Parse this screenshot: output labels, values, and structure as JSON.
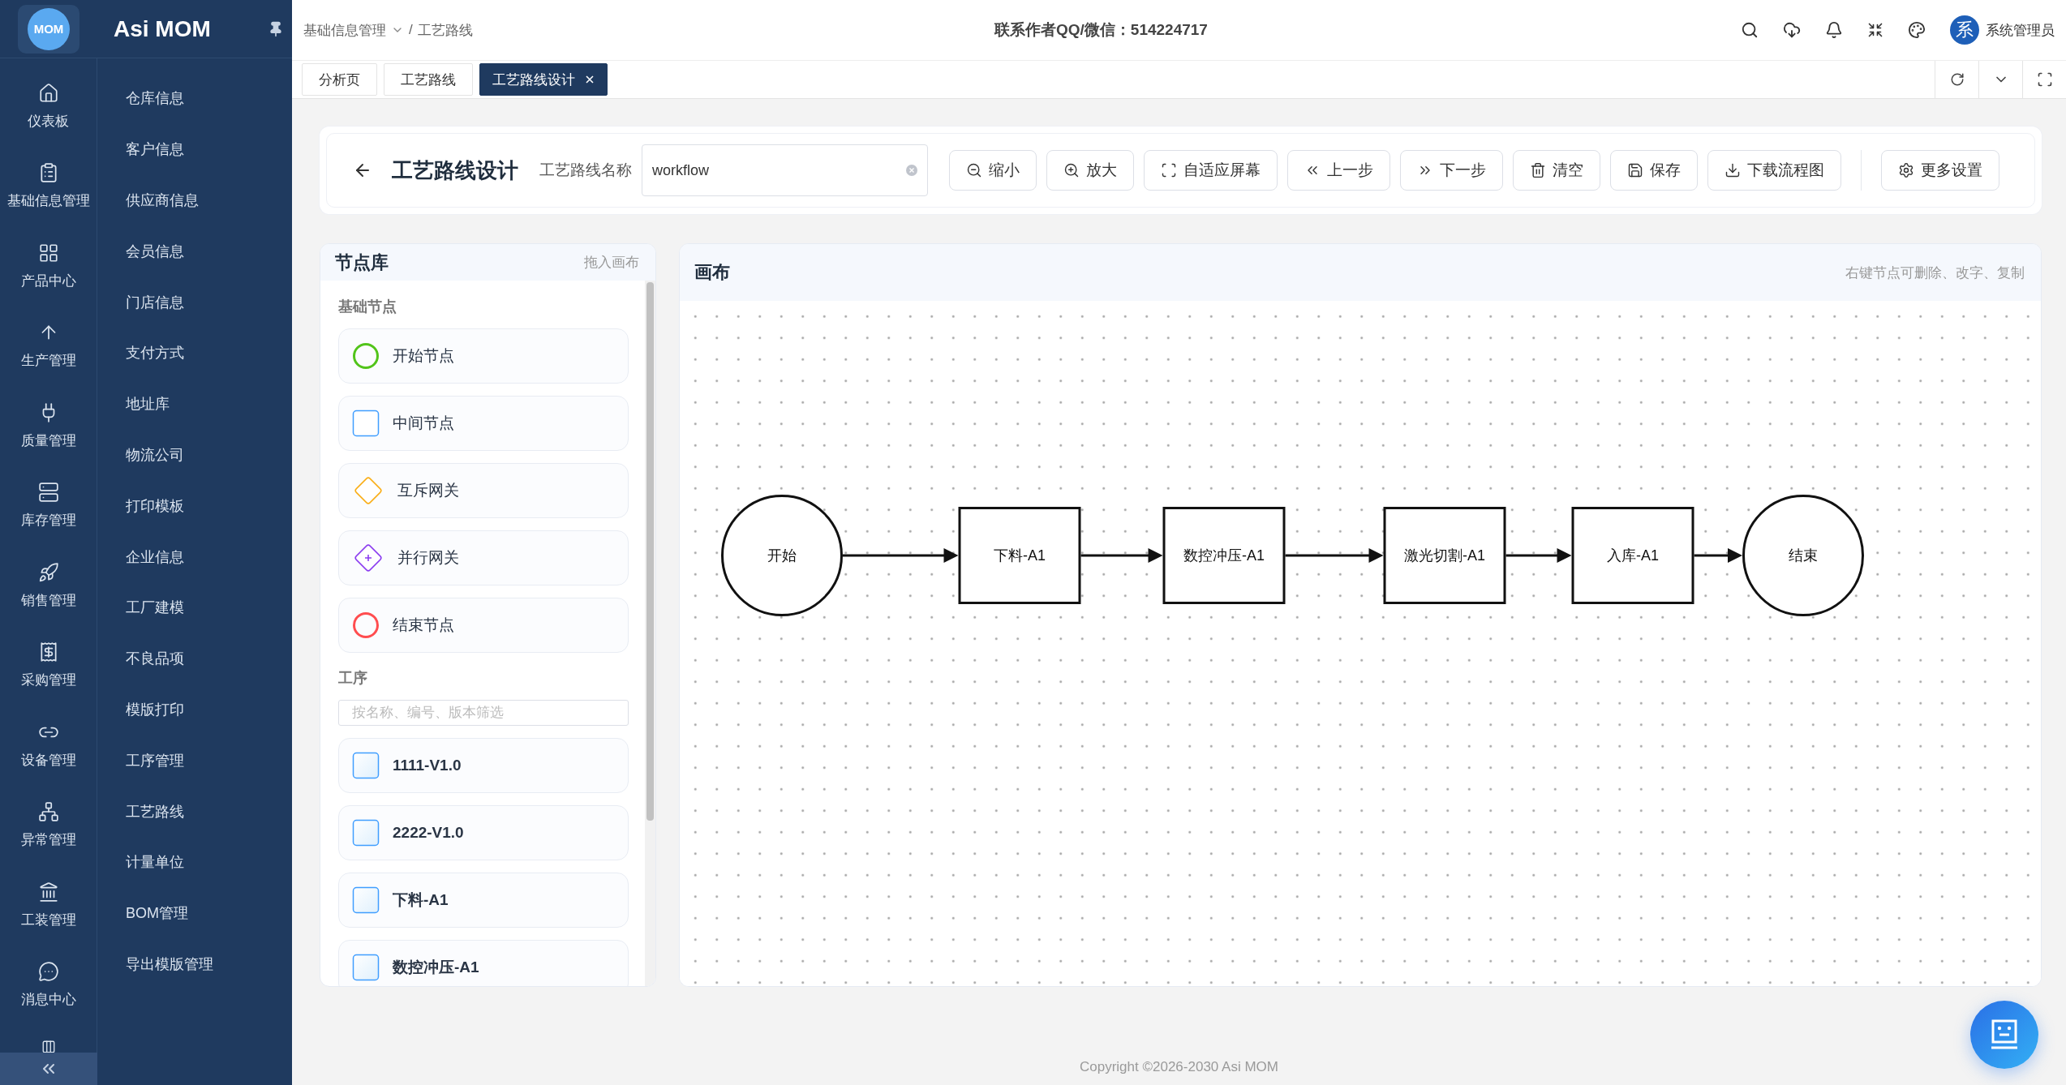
{
  "sidebar": {
    "logo_text": "MOM",
    "app_name": "Asi MOM",
    "rail": [
      {
        "kind": "home",
        "label": "仪表板"
      },
      {
        "kind": "clipboard",
        "label": "基础信息管理"
      },
      {
        "kind": "grid",
        "label": "产品中心"
      },
      {
        "kind": "arrow-up",
        "label": "生产管理"
      },
      {
        "kind": "plug",
        "label": "质量管理"
      },
      {
        "kind": "cabinet",
        "label": "库存管理"
      },
      {
        "kind": "rocket",
        "label": "销售管理"
      },
      {
        "kind": "receipt",
        "label": "采购管理"
      },
      {
        "kind": "link",
        "label": "设备管理"
      },
      {
        "kind": "network",
        "label": "异常管理"
      },
      {
        "kind": "bank",
        "label": "工装管理"
      },
      {
        "kind": "chat",
        "label": "消息中心"
      }
    ],
    "submenu": [
      "仓库信息",
      "客户信息",
      "供应商信息",
      "会员信息",
      "门店信息",
      "支付方式",
      "地址库",
      "物流公司",
      "打印模板",
      "企业信息",
      "工厂建模",
      "不良品项",
      "模版打印",
      "工序管理",
      "工艺路线",
      "计量单位",
      "BOM管理",
      "导出模版管理"
    ]
  },
  "header": {
    "breadcrumb": {
      "parent": "基础信息管理",
      "separator": "/",
      "current": "工艺路线"
    },
    "contact": "联系作者QQ/微信：514224717",
    "avatar": "系",
    "user": "系统管理员"
  },
  "tabs": [
    {
      "label": "分析页",
      "selected": false
    },
    {
      "label": "工艺路线",
      "selected": false
    },
    {
      "label": "工艺路线设计",
      "selected": true
    }
  ],
  "toolbar": {
    "title": "工艺路线设计",
    "name_label": "工艺路线名称",
    "name_value": "workflow",
    "buttons": [
      {
        "kind": "zoom-out",
        "label": "缩小"
      },
      {
        "kind": "zoom-in",
        "label": "放大"
      },
      {
        "kind": "fit",
        "label": "自适应屏幕"
      },
      {
        "kind": "undo",
        "label": "上一步"
      },
      {
        "kind": "redo",
        "label": "下一步"
      },
      {
        "kind": "clear",
        "label": "清空"
      },
      {
        "kind": "save",
        "label": "保存"
      },
      {
        "kind": "download",
        "label": "下载流程图"
      },
      {
        "kind": "settings",
        "label": "更多设置"
      }
    ]
  },
  "node_library": {
    "title": "节点库",
    "hint": "拖入画布",
    "basic_section": "基础节点",
    "basic_nodes": [
      {
        "kind": "start",
        "label": "开始节点",
        "color": "#52c41a"
      },
      {
        "kind": "task",
        "label": "中间节点",
        "color": "#409eff"
      },
      {
        "kind": "exclusive",
        "label": "互斥网关",
        "color": "#faad14"
      },
      {
        "kind": "parallel",
        "label": "并行网关",
        "color": "#8b3cf0"
      },
      {
        "kind": "end",
        "label": "结束节点",
        "color": "#ff4d4f"
      }
    ],
    "process_section": "工序",
    "filter_placeholder": "按名称、编号、版本筛选",
    "processes": [
      "1111-V1.0",
      "2222-V1.0",
      "下料-A1",
      "数控冲压-A1"
    ]
  },
  "canvas": {
    "title": "画布",
    "hint": "右键节点可删除、改字、复制",
    "nodes": [
      {
        "kind": "start",
        "label": "开始"
      },
      {
        "kind": "task",
        "label": "下料-A1"
      },
      {
        "kind": "task",
        "label": "数控冲压-A1"
      },
      {
        "kind": "task",
        "label": "激光切割-A1"
      },
      {
        "kind": "task",
        "label": "入库-A1"
      },
      {
        "kind": "end",
        "label": "结束"
      }
    ]
  },
  "footer": {
    "copyright": "Copyright ©2026-2030 Asi MOM"
  }
}
